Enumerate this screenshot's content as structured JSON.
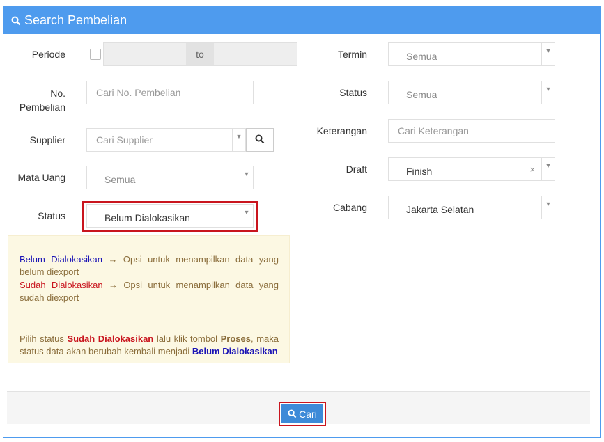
{
  "header": {
    "title": "Search Pembelian",
    "icon": "search-icon"
  },
  "left": {
    "periode": {
      "label": "Periode",
      "to_label": "to",
      "checked": false
    },
    "no_pembelian": {
      "label_line1": "No.",
      "label_line2": "Pembelian",
      "placeholder": "Cari No. Pembelian"
    },
    "supplier": {
      "label": "Supplier",
      "placeholder": "Cari Supplier"
    },
    "mata_uang": {
      "label": "Mata Uang",
      "value": "Semua"
    },
    "status": {
      "label": "Status",
      "value": "Belum Dialokasikan"
    }
  },
  "right": {
    "termin": {
      "label": "Termin",
      "value": "Semua"
    },
    "status": {
      "label": "Status",
      "value": "Semua"
    },
    "keterangan": {
      "label": "Keterangan",
      "placeholder": "Cari Keterangan"
    },
    "draft": {
      "label": "Draft",
      "value": "Finish",
      "clear": "×"
    },
    "cabang": {
      "label": "Cabang",
      "value": "Jakarta Selatan"
    }
  },
  "info": {
    "line1_term": "Belum Dialokasikan",
    "line1_text": "→ Opsi untuk menampilkan data yang belum diexport",
    "line2_term": "Sudah Dialokasikan",
    "line2_text": "→ Opsi untuk menampilkan data yang sudah diexport",
    "p2_a": "Pilih status ",
    "p2_b": "Sudah Dialokasikan",
    "p2_c": " lalu klik tombol ",
    "p2_d": "Proses",
    "p2_e": ", maka status data akan berubah kembali menjadi ",
    "p2_f": "Belum Dialokasikan"
  },
  "footer": {
    "cari_label": "Cari"
  },
  "colors": {
    "primary": "#4e9bee",
    "button": "#3d8ad8",
    "highlight": "#c9151e",
    "info_bg": "#fcf8e3"
  }
}
